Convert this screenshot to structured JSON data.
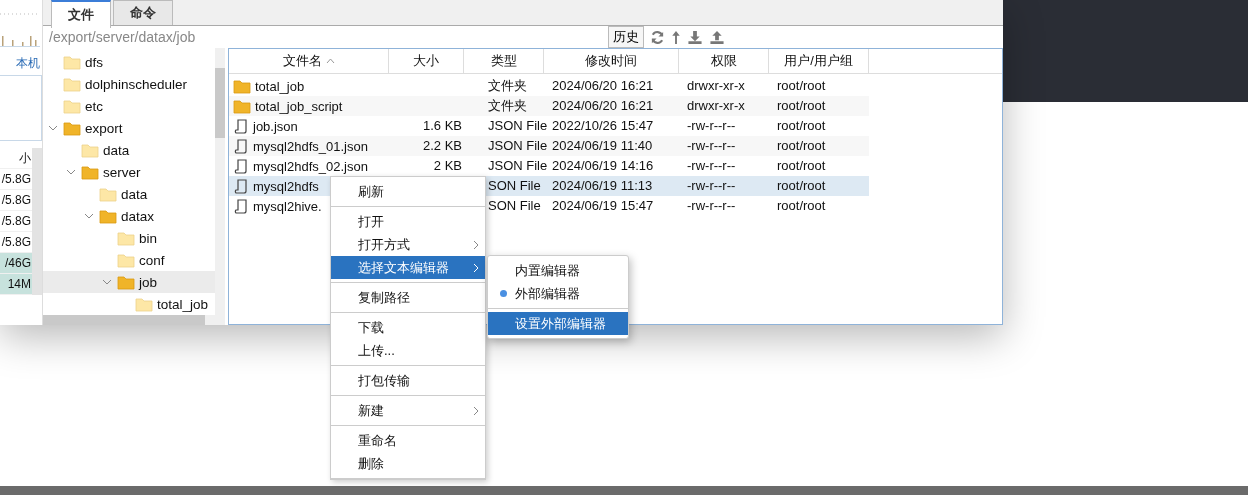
{
  "side_panel": {
    "host_label": "本机",
    "sizes_header": "小",
    "sizes": [
      {
        "text": "/5.8G",
        "selected": false
      },
      {
        "text": "/5.8G",
        "selected": false
      },
      {
        "text": "/5.8G",
        "selected": false
      },
      {
        "text": "/5.8G",
        "selected": false
      },
      {
        "text": "/46G",
        "selected": true
      },
      {
        "text": "14M",
        "selected": true
      }
    ]
  },
  "tabs": [
    {
      "label": "文件",
      "selected": true
    },
    {
      "label": "命令",
      "selected": false
    }
  ],
  "path": "/export/server/datax/job",
  "history_button": "历史",
  "tree": [
    {
      "name": "dfs",
      "expanded": false,
      "selected": false
    },
    {
      "name": "dolphinscheduler",
      "expanded": false,
      "selected": false
    },
    {
      "name": "etc",
      "expanded": false,
      "selected": false
    },
    {
      "name": "export",
      "expanded": true,
      "selected": false,
      "children": [
        {
          "name": "data",
          "expanded": false,
          "selected": false
        },
        {
          "name": "server",
          "expanded": true,
          "selected": false,
          "children": [
            {
              "name": "data",
              "expanded": false,
              "selected": false
            },
            {
              "name": "datax",
              "expanded": true,
              "selected": false,
              "children": [
                {
                  "name": "bin",
                  "expanded": false,
                  "selected": false
                },
                {
                  "name": "conf",
                  "expanded": false,
                  "selected": false
                },
                {
                  "name": "job",
                  "expanded": true,
                  "selected": true,
                  "children": [
                    {
                      "name": "total_job",
                      "expanded": false,
                      "selected": false
                    }
                  ]
                }
              ]
            }
          ]
        }
      ]
    }
  ],
  "table": {
    "columns": [
      "文件名",
      "大小",
      "类型",
      "修改时间",
      "权限",
      "用户/用户组"
    ],
    "rows": [
      {
        "kind": "folder",
        "selected": false,
        "cells": [
          "total_job",
          "",
          "文件夹",
          "2024/06/20 16:21",
          "drwxr-xr-x",
          "root/root"
        ]
      },
      {
        "kind": "folder",
        "selected": false,
        "cells": [
          "total_job_script",
          "",
          "文件夹",
          "2024/06/20 16:21",
          "drwxr-xr-x",
          "root/root"
        ]
      },
      {
        "kind": "file",
        "selected": false,
        "cells": [
          "job.json",
          "1.6 KB",
          "JSON File",
          "2022/10/26 15:47",
          "-rw-r--r--",
          "root/root"
        ]
      },
      {
        "kind": "file",
        "selected": false,
        "cells": [
          "mysql2hdfs_01.json",
          "2.2 KB",
          "JSON File",
          "2024/06/19 11:40",
          "-rw-r--r--",
          "root/root"
        ]
      },
      {
        "kind": "file",
        "selected": false,
        "cells": [
          "mysql2hdfs_02.json",
          "2 KB",
          "JSON File",
          "2024/06/19 14:16",
          "-rw-r--r--",
          "root/root"
        ]
      },
      {
        "kind": "file",
        "selected": true,
        "cells": [
          "mysql2hdfs",
          "",
          "SON File",
          "2024/06/19 11:13",
          "-rw-r--r--",
          "root/root"
        ]
      },
      {
        "kind": "file",
        "selected": false,
        "cells": [
          "mysql2hive.",
          "",
          "SON File",
          "2024/06/19 15:47",
          "-rw-r--r--",
          "root/root"
        ]
      }
    ]
  },
  "context_menu": {
    "groups": [
      [
        {
          "label": "刷新",
          "submenu": false,
          "selected": false
        }
      ],
      [
        {
          "label": "打开",
          "submenu": false,
          "selected": false
        },
        {
          "label": "打开方式",
          "submenu": true,
          "selected": false
        },
        {
          "label": "选择文本编辑器",
          "submenu": true,
          "selected": true
        }
      ],
      [
        {
          "label": "复制路径",
          "submenu": false,
          "selected": false
        }
      ],
      [
        {
          "label": "下载",
          "submenu": false,
          "selected": false
        },
        {
          "label": "上传...",
          "submenu": false,
          "selected": false
        }
      ],
      [
        {
          "label": "打包传输",
          "submenu": false,
          "selected": false
        }
      ],
      [
        {
          "label": "新建",
          "submenu": true,
          "selected": false
        }
      ],
      [
        {
          "label": "重命名",
          "submenu": false,
          "selected": false
        },
        {
          "label": "删除",
          "submenu": false,
          "selected": false
        }
      ]
    ]
  },
  "submenu": {
    "groups": [
      [
        {
          "label": "内置编辑器",
          "checked": false,
          "selected": false
        },
        {
          "label": "外部编辑器",
          "checked": true,
          "selected": false
        }
      ],
      [
        {
          "label": "设置外部编辑器",
          "checked": false,
          "selected": true
        }
      ]
    ]
  }
}
